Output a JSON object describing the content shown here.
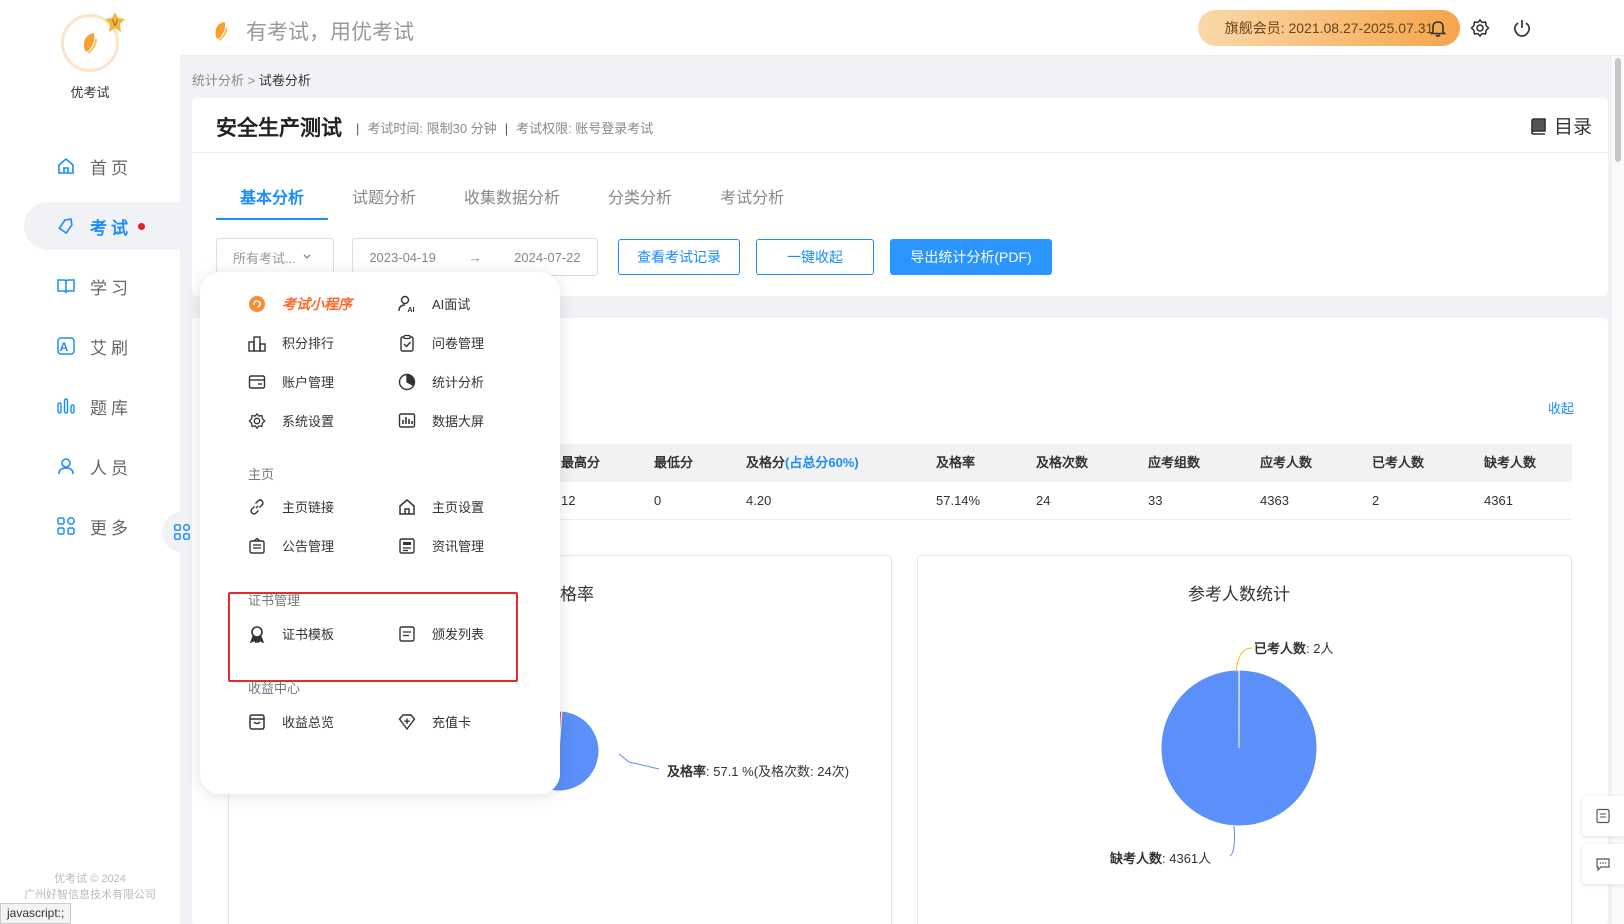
{
  "brand": {
    "name": "优考试",
    "slogan": "有考试，用优考试"
  },
  "sidebar": {
    "items": [
      {
        "label": "首页",
        "icon": "home-icon"
      },
      {
        "label": "考试",
        "icon": "tag-icon"
      },
      {
        "label": "学习",
        "icon": "book-icon"
      },
      {
        "label": "艾刷",
        "icon": "a-icon"
      },
      {
        "label": "题库",
        "icon": "bars-icon"
      },
      {
        "label": "人员",
        "icon": "user-icon"
      },
      {
        "label": "更多",
        "icon": "apps-icon"
      }
    ],
    "active_index": 1,
    "footer_line1": "优考试 © 2024",
    "footer_line2": "广州好智信息技术有限公司"
  },
  "header": {
    "vip_label": "旗舰会员: 2021.08.27-2025.07.31"
  },
  "breadcrumb": {
    "parent": "统计分析",
    "sep": " > ",
    "current": "试卷分析"
  },
  "exam": {
    "title": "安全生产测试",
    "meta_time": "考试时间: 限制30 分钟",
    "meta_permission": "考试权限: 账号登录考试",
    "meta_sep": "|",
    "catalog_label": "目录"
  },
  "tabs": [
    "基本分析",
    "试题分析",
    "收集数据分析",
    "分类分析",
    "考试分析"
  ],
  "filters": {
    "select_value": "所有考试...",
    "date_start": "2023-04-19",
    "date_arrow": "→",
    "date_end": "2024-07-22",
    "btn_records": "查看考试记录",
    "btn_collapse": "一键收起",
    "btn_export": "导出统计分析(PDF)"
  },
  "stats": {
    "collapse_link": "收起",
    "headers": [
      "最高分",
      "最低分",
      "及格分",
      "(占总分60%)",
      "及格率",
      "及格次数",
      "应考组数",
      "应考人数",
      "已考人数",
      "缺考人数"
    ],
    "values": [
      "12",
      "0",
      "4.20",
      "57.14%",
      "24",
      "33",
      "4363",
      "2",
      "4361"
    ]
  },
  "charts": {
    "pass_rate": {
      "title_visible": "及格率",
      "label_bold": "及格率",
      "label_rest": ": 57.1 %(及格次数: 24次)"
    },
    "attendance": {
      "title": "参考人数统计",
      "label_taken_bold": "已考人数",
      "label_taken_rest": ": 2人",
      "label_absent_bold": "缺考人数",
      "label_absent_rest": ": 4361人"
    }
  },
  "chart_data": [
    {
      "type": "pie",
      "title": "及格率",
      "slices": [
        {
          "name": "及格率",
          "value": 57.1,
          "color": "#5b8ff9"
        },
        {
          "name": "",
          "value": 42.9,
          "color": "#e8505b"
        }
      ]
    },
    {
      "type": "pie",
      "title": "参考人数统计",
      "slices": [
        {
          "name": "已考人数",
          "value": 2,
          "color": "#f6bd16"
        },
        {
          "name": "缺考人数",
          "value": 4361,
          "color": "#5b8ff9"
        }
      ]
    }
  ],
  "menu": {
    "mini_app": "考试小程序",
    "ai_interview": "AI面试",
    "ranking": "积分排行",
    "questionnaire": "问卷管理",
    "account": "账户管理",
    "statistics": "统计分析",
    "system": "系统设置",
    "big_screen": "数据大屏",
    "section_home": "主页",
    "home_link": "主页链接",
    "home_settings": "主页设置",
    "notice": "公告管理",
    "news": "资讯管理",
    "section_cert": "证书管理",
    "cert_template": "证书模板",
    "issue_list": "颁发列表",
    "section_revenue": "收益中心",
    "revenue_overview": "收益总览",
    "recharge_card": "充值卡"
  },
  "status_bar": "javascript:;",
  "colors": {
    "accent": "#1a8cff",
    "highlight_box": "#e42a2a",
    "vip_gradient_start": "#fbd8a9",
    "vip_gradient_end": "#f5a54b"
  }
}
